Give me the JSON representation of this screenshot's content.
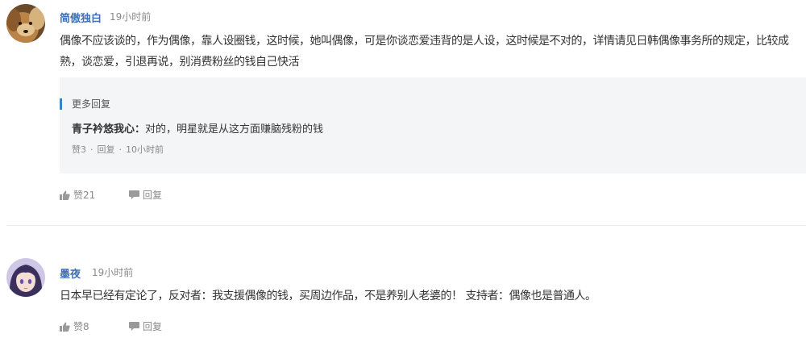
{
  "comments": [
    {
      "username": "简傲独白",
      "time": "19小时前",
      "text": "偶像不应该谈的，作为偶像，靠人设圈钱，这时候，她叫偶像，可是你谈恋爱违背的是人设，这时候是不对的，详情请见日韩偶像事务所的规定，比较成熟，谈恋爱，引退再说，别消费粉丝的钱自己快活",
      "avatar_icon": "dog-avatar",
      "more_replies_label": "更多回复",
      "reply": {
        "username": "青子衿悠我心：",
        "text": "对的，明星就是从这方面赚脑残粉的钱",
        "likes": "赞3",
        "reply_label": "回复",
        "time": "10小时前"
      },
      "likes": "赞21",
      "reply_label": "回复"
    },
    {
      "username": "墨夜",
      "time": "19小时前",
      "text": "日本早已经有定论了，反对者：我支援偶像的钱，买周边作品，不是养别人老婆的！ 支持者：偶像也是普通人。",
      "avatar_icon": "anime-girl-avatar",
      "likes": "赞8",
      "reply_label": "回复"
    }
  ],
  "colors": {
    "username": "#3d6fb5",
    "accent_bar": "#3d82c4",
    "meta": "#8a8a8a",
    "reply_bg": "#f4f5f6"
  }
}
